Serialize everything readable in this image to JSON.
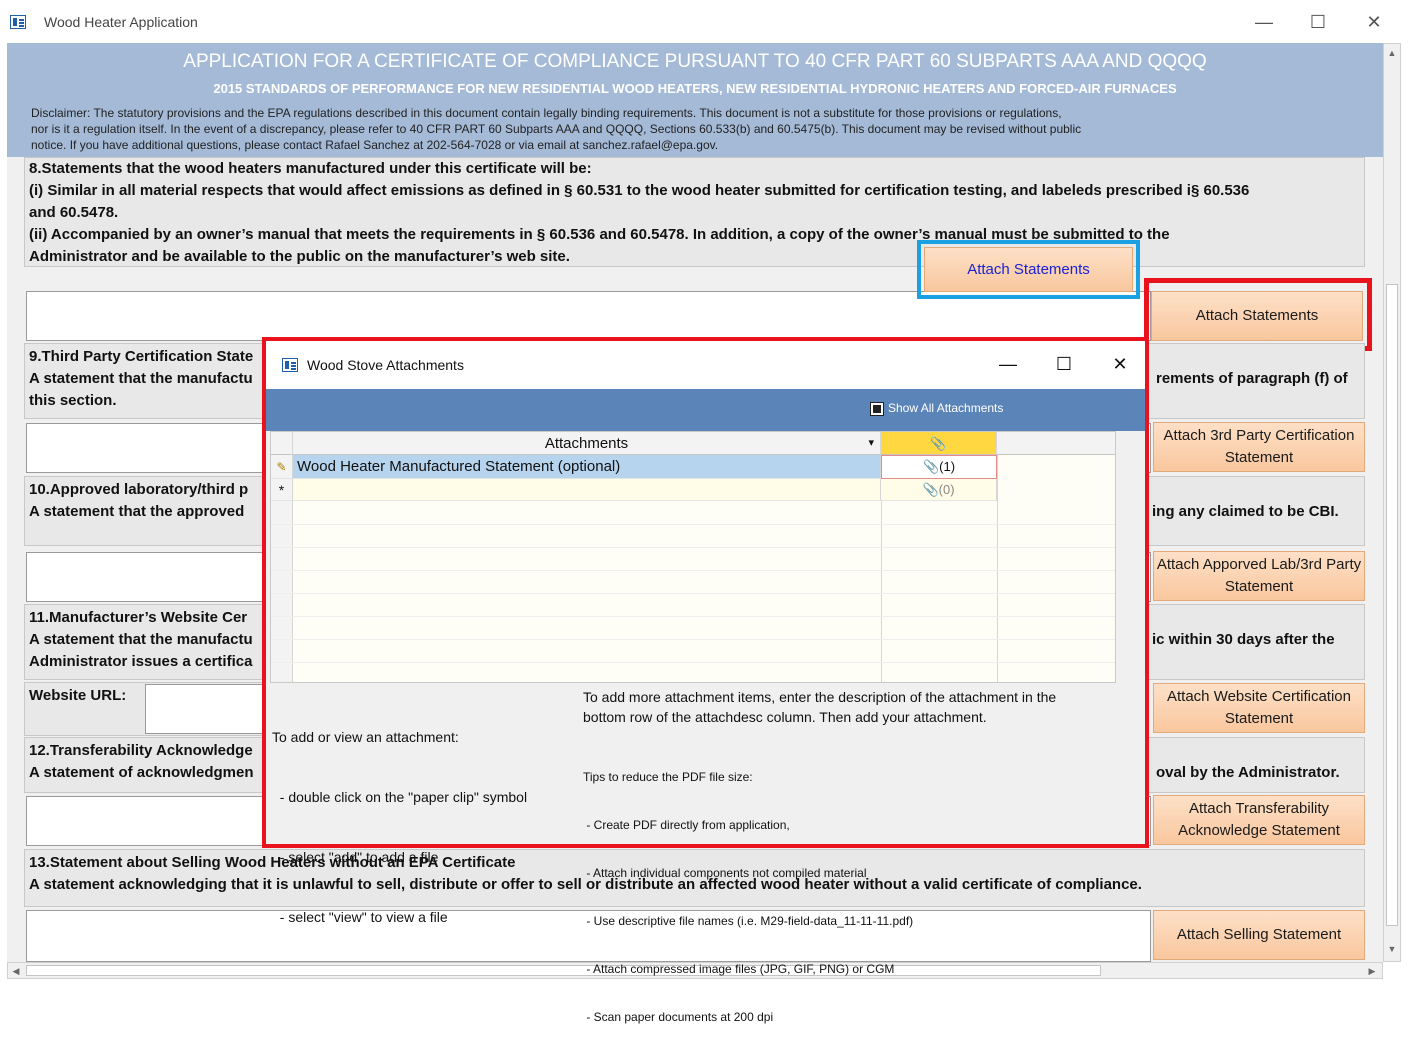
{
  "window": {
    "title": "Wood Heater Application",
    "controls": {
      "minimize": "—",
      "maximize": "☐",
      "close": "✕"
    }
  },
  "header": {
    "title": "APPLICATION FOR A CERTIFICATE OF COMPLIANCE PURSUANT TO 40 CFR PART 60 SUBPARTS AAA AND QQQQ",
    "subtitle": "2015 STANDARDS OF PERFORMANCE FOR NEW RESIDENTIAL WOOD HEATERS, NEW RESIDENTIAL HYDRONIC HEATERS AND FORCED-AIR FURNACES",
    "disclaimer_1": "Disclaimer:  The statutory provisions and the EPA regulations described in this document contain legally binding requirements.  This document is not a substitute for those provisions or regulations,",
    "disclaimer_2": "nor is it a regulation itself.  In the event of a discrepancy, please refer to 40 CFR PART 60 Subparts AAA and QQQQ, Sections 60.533(b) and 60.5475(b).  This document may be revised without public",
    "disclaimer_3": "notice.  If you have additional questions, please contact Rafael Sanchez at 202-564-7028 or via email at sanchez.rafael@epa.gov."
  },
  "sections": {
    "s8": {
      "line1": "8.Statements that the wood heaters manufactured under this certificate will be:",
      "line2": "(i)  Similar in all material respects that would affect emissions as defined in § 60.531 to the wood heater submitted for certification testing, and labeleds prescribed i§ 60.536",
      "line3": "and 60.5478.",
      "line4": "(ii)  Accompanied by an owner’s manual that meets the requirements in § 60.536 and 60.5478. In addition, a copy of the owner’s manual must be submitted to the",
      "line5": "Administrator and be available to the public on the manufacturer’s web site.",
      "button_highlight": "Attach Statements",
      "button": "Attach Statements"
    },
    "s9": {
      "line1": "9.Third Party Certification State",
      "line2": "A statement that the manufactu",
      "line2_right": "rements of paragraph (f) of",
      "line3": "this section.",
      "button": "Attach 3rd Party Certification Statement"
    },
    "s10": {
      "line1": "10.Approved laboratory/third p",
      "line2": "A statement that the approved",
      "line2_right": "ing any claimed to be CBI.",
      "button": "Attach Apporved Lab/3rd Party Statement"
    },
    "s11": {
      "line1": "11.Manufacturer’s Website Cer",
      "line2": "A statement that the manufactu",
      "line2_right": "ic within 30 days after the",
      "line3": "Administrator issues a certifica",
      "url_label": "Website URL:",
      "button": "Attach Website Certification Statement"
    },
    "s12": {
      "line1": "12.Transferability Acknowledge",
      "line2": "A statement of acknowledgmen",
      "line2_right": "oval by the Administrator.",
      "button": "Attach Transferability Acknowledge Statement"
    },
    "s13": {
      "line1": "13.Statement about Selling Wood Heaters without an EPA Certificate",
      "line2": "A statement acknowledging that it is unlawful to sell, distribute or offer to sell or distribute an affected wood heater without a valid certificate of compliance.",
      "button": "Attach Selling Statement"
    }
  },
  "dialog": {
    "title": "Wood Stove Attachments",
    "controls": {
      "minimize": "—",
      "maximize": "☐",
      "close": "✕"
    },
    "show_all_label": "Show All Attachments",
    "columns": {
      "attachments": "Attachments",
      "sort_glyph": "▾",
      "clip": "📎"
    },
    "rows": [
      {
        "selector": "✎",
        "description": "Wood Heater Manufactured Statement (optional)",
        "count": "(1)"
      },
      {
        "selector": "*",
        "description": "",
        "count": "(0)"
      }
    ],
    "help_left": [
      "To add or view an attachment:",
      "  - double click on the \"paper clip\" symbol",
      "  - select \"add\" to add a file",
      "  - select \"view\" to view a file"
    ],
    "help_right_1": "To add more attachment items, enter the description of the attachment in the",
    "help_right_2": "bottom row of the attachdesc column. Then add your attachment.",
    "tips": [
      "Tips to reduce the PDF file size:",
      " - Create PDF directly from application,",
      " - Attach individual components not compiled material",
      " - Use descriptive file names (i.e. M29-field-data_11-11-11.pdf)",
      " - Attach compressed image files (JPG, GIF, PNG) or CGM",
      " - Scan paper documents at 200 dpi"
    ]
  },
  "colors": {
    "header_bg": "#a5bad6",
    "dialog_band": "#5b84b8",
    "highlight_red": "#e8131c",
    "highlight_blue": "#1ba1e2",
    "button_orange": "#f9c79e",
    "row_selected": "#b7d4ee",
    "clip_header": "#ffd740"
  }
}
